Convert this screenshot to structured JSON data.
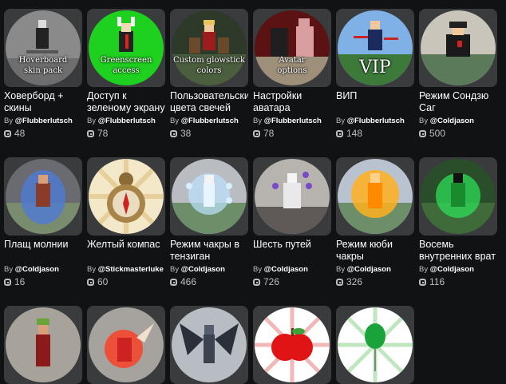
{
  "items": [
    {
      "name": "Ховерборд + скины",
      "by": "By",
      "creator": "@Flubberlutsch",
      "price": "48",
      "overlay": [
        "Hoverboard",
        "skin pack"
      ],
      "icon": "hoverboard-icon"
    },
    {
      "name": "Доступ к зеленому экрану",
      "by": "By",
      "creator": "@Flubberlutsch",
      "price": "78",
      "overlay": [
        "Greenscreen",
        "access"
      ],
      "icon": "greenscreen-icon"
    },
    {
      "name": "Пользовательские цвета свечей",
      "by": "By",
      "creator": "@Flubberlutsch",
      "price": "38",
      "overlay": [
        "Custom glowstick",
        "colors"
      ],
      "icon": "glowstick-icon"
    },
    {
      "name": "Настройки аватара",
      "by": "By",
      "creator": "@Flubberlutsch",
      "price": "78",
      "overlay": [
        "Avatar",
        "options"
      ],
      "icon": "avatar-options-icon"
    },
    {
      "name": "ВИП",
      "by": "By",
      "creator": "@Flubberlutsch",
      "price": "148",
      "overlay": [
        "VIP"
      ],
      "icon": "vip-icon"
    },
    {
      "name": "Режим Сондзю Саг",
      "by": "By",
      "creator": "@Coldjason",
      "price": "500",
      "overlay": [],
      "icon": "sage-mode-icon"
    },
    {
      "name": "Плащ молнии",
      "by": "By",
      "creator": "@Coldjason",
      "price": "16",
      "overlay": [],
      "icon": "lightning-cloak-icon"
    },
    {
      "name": "Желтый компас",
      "by": "By",
      "creator": "@Stickmasterluke",
      "price": "60",
      "overlay": [],
      "icon": "compass-icon"
    },
    {
      "name": "Режим чакры в тензиган",
      "by": "By",
      "creator": "@Coldjason",
      "price": "466",
      "overlay": [],
      "icon": "tenseigan-icon"
    },
    {
      "name": "Шесть путей",
      "by": "By",
      "creator": "@Coldjason",
      "price": "726",
      "overlay": [],
      "icon": "six-paths-icon"
    },
    {
      "name": "Режим кюби чакры",
      "by": "By",
      "creator": "@Coldjason",
      "price": "326",
      "overlay": [],
      "icon": "kyuubi-icon"
    },
    {
      "name": "Восемь внутренних врат",
      "by": "By",
      "creator": "@Coldjason",
      "price": "116",
      "overlay": [],
      "icon": "eight-gates-icon"
    },
    {
      "name": "",
      "by": "",
      "creator": "",
      "price": "",
      "overlay": [],
      "icon": "warrior-icon"
    },
    {
      "name": "",
      "by": "",
      "creator": "",
      "price": "",
      "overlay": [],
      "icon": "red-aura-icon"
    },
    {
      "name": "",
      "by": "",
      "creator": "",
      "price": "",
      "overlay": [],
      "icon": "dark-wings-icon"
    },
    {
      "name": "",
      "by": "",
      "creator": "",
      "price": "",
      "overlay": [],
      "icon": "apple-icon"
    },
    {
      "name": "",
      "by": "",
      "creator": "",
      "price": "",
      "overlay": [],
      "icon": "balloon-icon"
    }
  ]
}
